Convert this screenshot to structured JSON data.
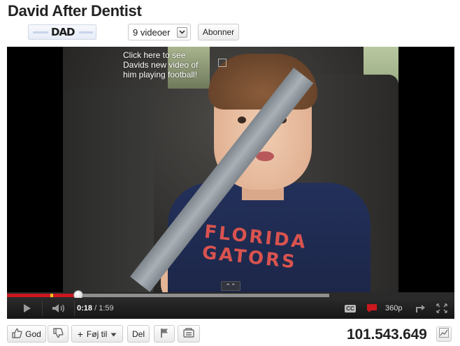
{
  "page": {
    "title": "David After Dentist"
  },
  "channel": {
    "logo_text": "DAD",
    "videos_label": "9 videoer",
    "subscribe_label": "Abonner"
  },
  "player": {
    "annotation": "Click here to see Davids new video of him playing football!",
    "shirt_text": "FLORIDA GATORS",
    "progress": {
      "played_fraction": 0.16,
      "loaded_fraction": 0.72
    },
    "current_time": "0:18",
    "time_separator": " / ",
    "duration": "1:59",
    "cc_label": "CC",
    "quality": "360p"
  },
  "actions": {
    "like_label": "God",
    "add_to_label": "Føj til",
    "share_label": "Del",
    "view_count": "101.543.649"
  },
  "icons": {
    "like": "thumbs-up-icon",
    "dislike": "thumbs-down-icon",
    "play": "play-icon",
    "volume": "volume-icon",
    "comment": "comment-icon",
    "share": "share-arrow-icon",
    "fullscreen": "fullscreen-icon",
    "flag": "flag-icon",
    "transcript": "transcript-icon",
    "stats": "stats-chart-icon"
  },
  "colors": {
    "progress_played": "#cc181e",
    "progress_loaded": "#8f8f8f",
    "marker": "#f4c021"
  }
}
